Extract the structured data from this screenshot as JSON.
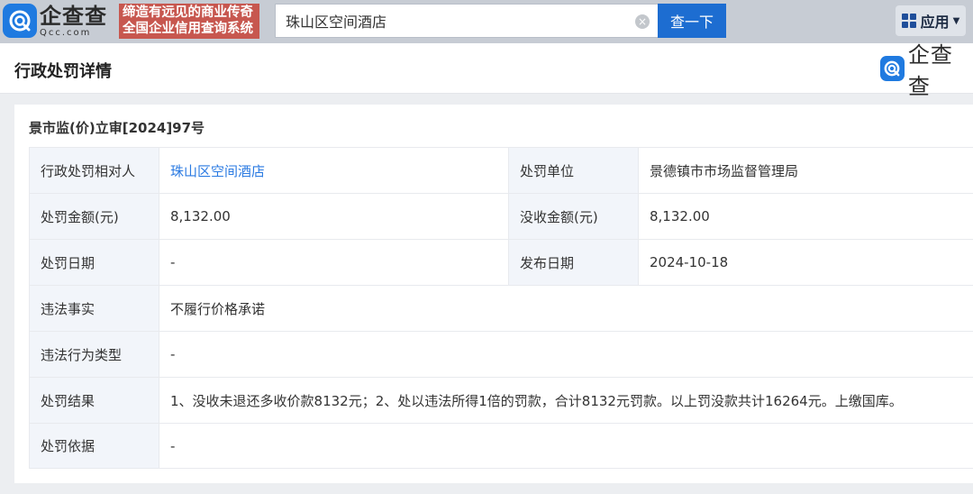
{
  "header": {
    "logo_cn": "企查查",
    "logo_en": "Qcc.com",
    "slogan_line1": "缔造有远见的商业传奇",
    "slogan_line2": "全国企业信用查询系统",
    "search_value": "珠山区空间酒店",
    "search_button": "查一下",
    "apps_label": "应用"
  },
  "page": {
    "title": "行政处罚详情",
    "brand_text": "企查查"
  },
  "record": {
    "doc_number": "景市监(价)立审[2024]97号",
    "rows": [
      {
        "label": "行政处罚相对人",
        "value": "珠山区空间酒店",
        "label2": "处罚单位",
        "value2": "景德镇市市场监督管理局"
      },
      {
        "label": "处罚金额(元)",
        "value": "8,132.00",
        "label2": "没收金额(元)",
        "value2": "8,132.00"
      },
      {
        "label": "处罚日期",
        "value": "-",
        "label2": "发布日期",
        "value2": "2024-10-18"
      },
      {
        "label": "违法事实",
        "value": "不履行价格承诺"
      },
      {
        "label": "违法行为类型",
        "value": "-"
      },
      {
        "label": "处罚结果",
        "value": "1、没收未退还多收价款8132元；2、处以违法所得1倍的罚款，合计8132元罚款。以上罚没款共计16264元。上缴国库。"
      },
      {
        "label": "处罚依据",
        "value": "-"
      }
    ]
  },
  "colors": {
    "search_button": "#1d6dd1",
    "slogan_bg": "#c7574f",
    "link": "#2a7ae2",
    "label_bg": "#f2f5fa"
  }
}
